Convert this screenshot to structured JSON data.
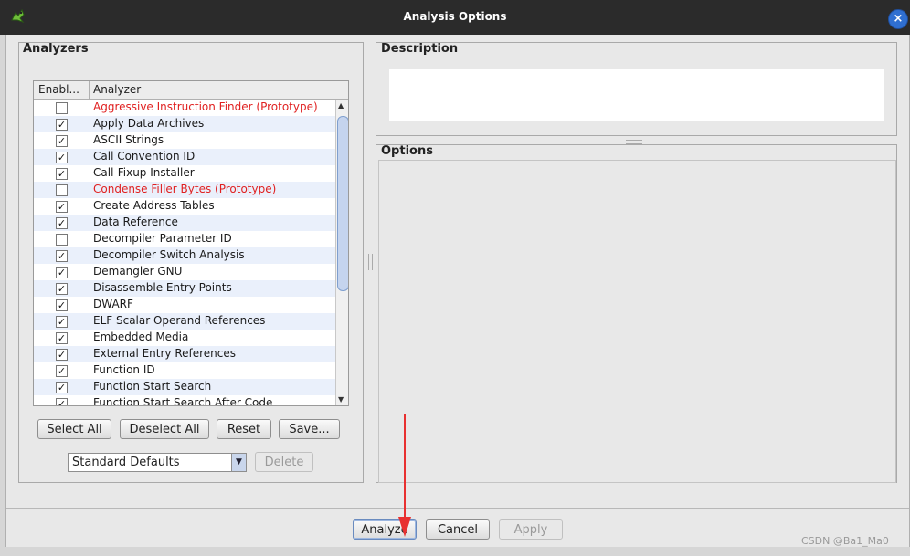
{
  "window": {
    "title": "Analysis Options",
    "close_icon": "close-icon",
    "app_icon": "ghidra-dragon-icon"
  },
  "analyzers": {
    "title": "Analyzers",
    "columns": [
      "Enabl...",
      "Analyzer"
    ],
    "rows": [
      {
        "enabled": false,
        "name": "Aggressive Instruction Finder (Prototype)",
        "prototype": true
      },
      {
        "enabled": true,
        "name": "Apply Data Archives",
        "prototype": false
      },
      {
        "enabled": true,
        "name": "ASCII Strings",
        "prototype": false
      },
      {
        "enabled": true,
        "name": "Call Convention ID",
        "prototype": false
      },
      {
        "enabled": true,
        "name": "Call-Fixup Installer",
        "prototype": false
      },
      {
        "enabled": false,
        "name": "Condense Filler Bytes (Prototype)",
        "prototype": true
      },
      {
        "enabled": true,
        "name": "Create Address Tables",
        "prototype": false
      },
      {
        "enabled": true,
        "name": "Data Reference",
        "prototype": false
      },
      {
        "enabled": false,
        "name": "Decompiler Parameter ID",
        "prototype": false
      },
      {
        "enabled": true,
        "name": "Decompiler Switch Analysis",
        "prototype": false
      },
      {
        "enabled": true,
        "name": "Demangler GNU",
        "prototype": false
      },
      {
        "enabled": true,
        "name": "Disassemble Entry Points",
        "prototype": false
      },
      {
        "enabled": true,
        "name": "DWARF",
        "prototype": false
      },
      {
        "enabled": true,
        "name": "ELF Scalar Operand References",
        "prototype": false
      },
      {
        "enabled": true,
        "name": "Embedded Media",
        "prototype": false
      },
      {
        "enabled": true,
        "name": "External Entry References",
        "prototype": false
      },
      {
        "enabled": true,
        "name": "Function ID",
        "prototype": false
      },
      {
        "enabled": true,
        "name": "Function Start Search",
        "prototype": false
      },
      {
        "enabled": true,
        "name": "Function Start Search After Code",
        "prototype": false
      }
    ],
    "buttons": {
      "select_all": "Select All",
      "deselect_all": "Deselect All",
      "reset": "Reset",
      "save": "Save..."
    },
    "profile": "Standard Defaults",
    "delete": "Delete"
  },
  "description": {
    "title": "Description",
    "text": ""
  },
  "options": {
    "title": "Options"
  },
  "footer": {
    "analyze": "Analyze",
    "cancel": "Cancel",
    "apply": "Apply"
  },
  "watermark": "CSDN @Ba1_Ma0",
  "colors": {
    "prototype": "#e02020",
    "arrow": "#e83030"
  }
}
